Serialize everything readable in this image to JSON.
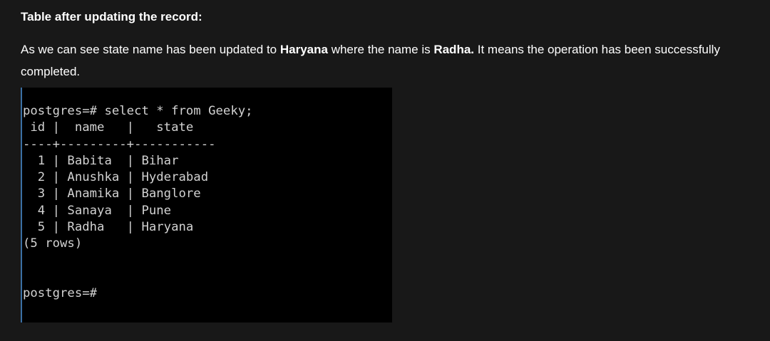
{
  "heading": "Table after updating the record:",
  "paragraph": {
    "part1": "As we can see state name has been updated to ",
    "bold1": "Haryana",
    "part2": " where the name is ",
    "bold2": "Radha.",
    "part3": " It means the operation has been successfully completed."
  },
  "terminal": {
    "query": "postgres=# select * from Geeky;",
    "header": " id |  name   |   state",
    "separator": "----+---------+-----------",
    "rows": [
      "  1 | Babita  | Bihar",
      "  2 | Anushka | Hyderabad",
      "  3 | Anamika | Banglore",
      "  4 | Sanaya  | Pune",
      "  5 | Radha   | Haryana"
    ],
    "row_count": "(5 rows)",
    "blank": "",
    "prompt": "postgres=#"
  }
}
